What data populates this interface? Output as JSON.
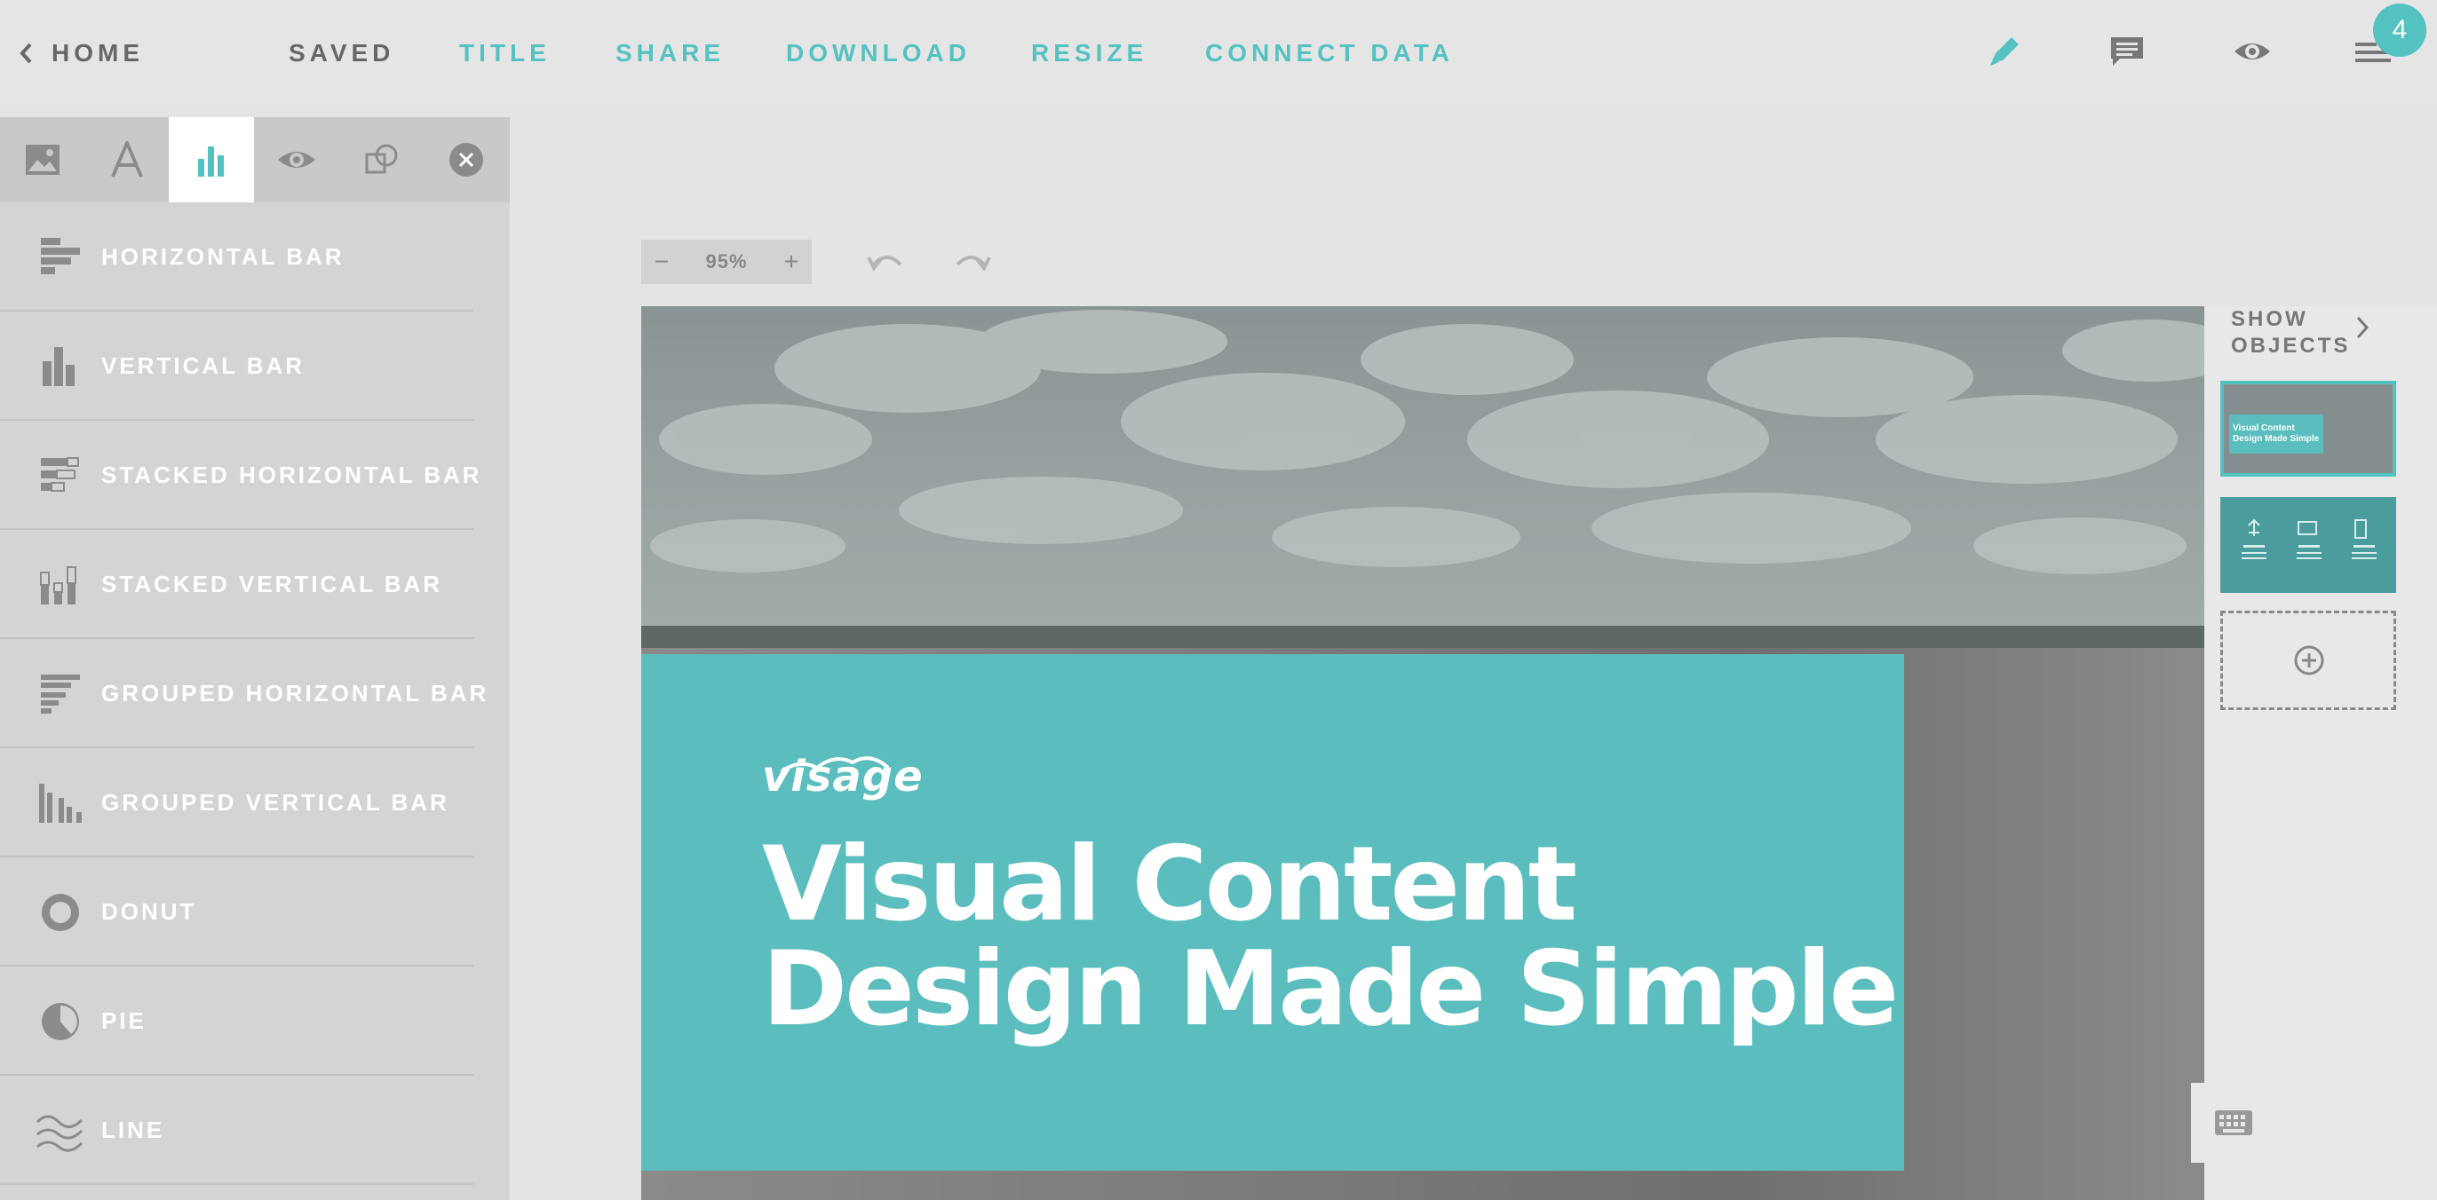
{
  "topbar": {
    "home_label": "HOME",
    "saved_label": "SAVED",
    "menu": [
      "TITLE",
      "SHARE",
      "DOWNLOAD",
      "RESIZE",
      "CONNECT DATA"
    ],
    "notification_count": "4",
    "icons": [
      "pencil-icon",
      "comment-icon",
      "eye-icon",
      "layers-icon"
    ],
    "accent_color": "#55c2c2"
  },
  "sidebar": {
    "tabs": [
      "image-icon",
      "text-icon",
      "chart-icon",
      "eye-icon",
      "shapes-icon",
      "close-icon"
    ],
    "active_tab": "chart-icon",
    "chart_types": [
      "HORIZONTAL BAR",
      "VERTICAL BAR",
      "STACKED HORIZONTAL BAR",
      "STACKED VERTICAL BAR",
      "GROUPED HORIZONTAL BAR",
      "GROUPED VERTICAL BAR",
      "DONUT",
      "PIE",
      "LINE"
    ]
  },
  "canvas": {
    "zoom": "95%",
    "zoom_out": "−",
    "zoom_in": "+",
    "logo_text": "visage",
    "title_line1": "Visual Content",
    "title_line2": "Design Made Simple",
    "hero_color": "#5bbdbd"
  },
  "pages_panel": {
    "show_objects_line1": "SHOW",
    "show_objects_line2": "OBJECTS",
    "thumbnails": [
      {
        "line1": "Visual Content",
        "line2": "Design Made Simple"
      },
      {
        "line1": ""
      }
    ],
    "add_page_icon": "plus-circle-icon"
  }
}
